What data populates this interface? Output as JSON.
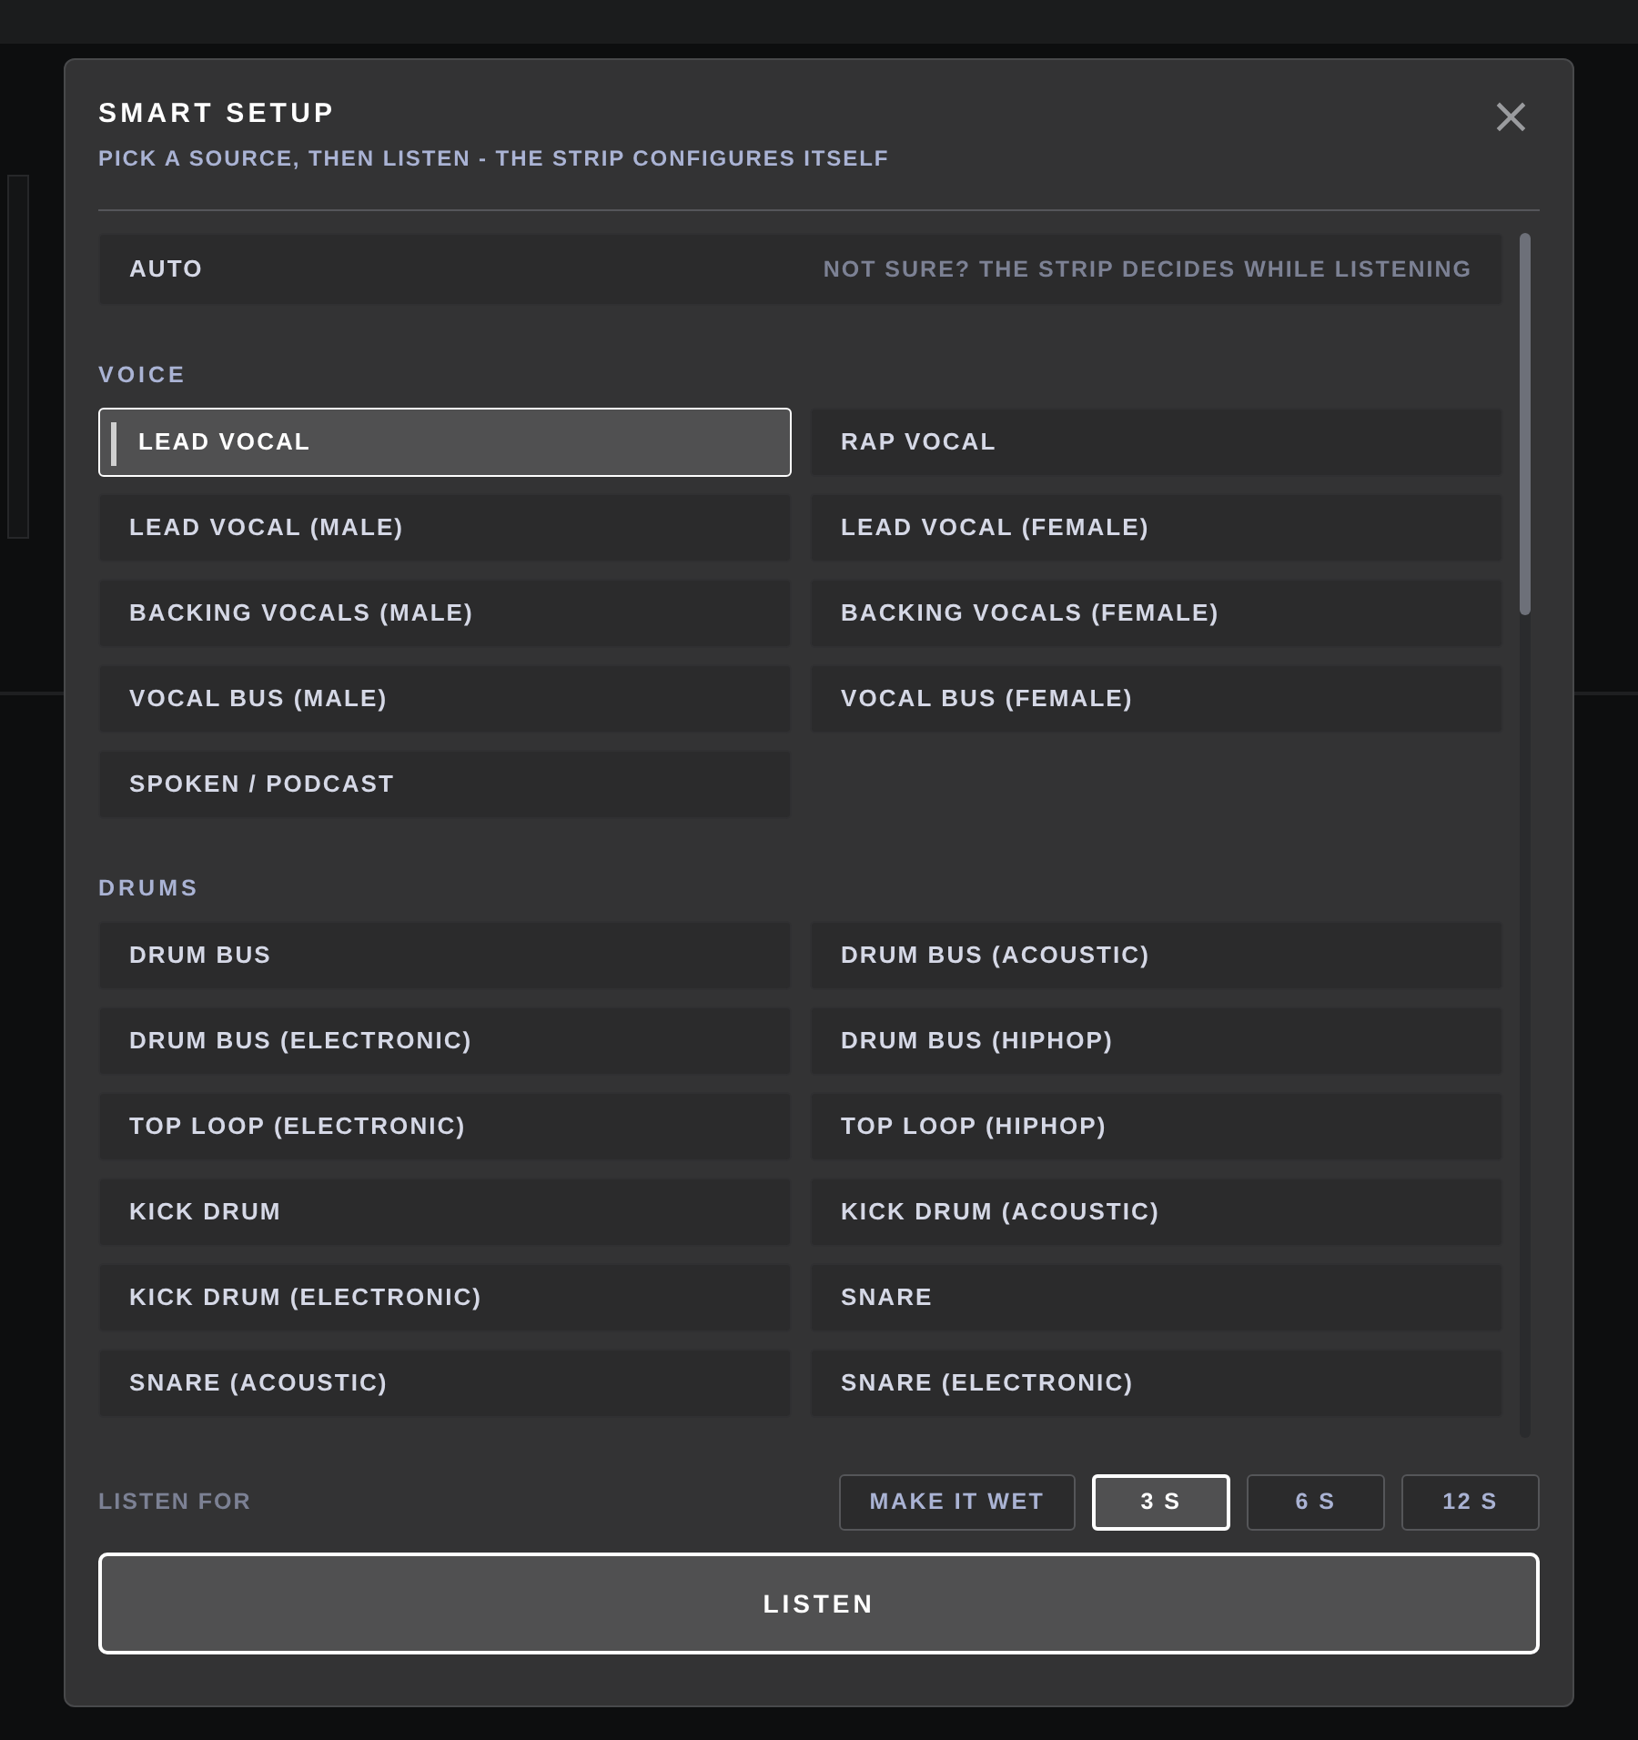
{
  "dialog": {
    "title": "SMART SETUP",
    "subtitle": "PICK A SOURCE, THEN LISTEN - THE STRIP CONFIGURES ITSELF",
    "close": "×"
  },
  "auto": {
    "label": "AUTO",
    "hint": "NOT SURE? THE STRIP DECIDES WHILE LISTENING",
    "selected": false
  },
  "sections": [
    {
      "heading": "VOICE",
      "items": [
        {
          "label": "LEAD VOCAL",
          "selected": true
        },
        {
          "label": "RAP VOCAL",
          "selected": false
        },
        {
          "label": "LEAD VOCAL (MALE)",
          "selected": false
        },
        {
          "label": "LEAD VOCAL (FEMALE)",
          "selected": false
        },
        {
          "label": "BACKING VOCALS (MALE)",
          "selected": false
        },
        {
          "label": "BACKING VOCALS (FEMALE)",
          "selected": false
        },
        {
          "label": "VOCAL BUS (MALE)",
          "selected": false
        },
        {
          "label": "VOCAL BUS (FEMALE)",
          "selected": false
        },
        {
          "label": "SPOKEN / PODCAST",
          "selected": false
        }
      ]
    },
    {
      "heading": "DRUMS",
      "items": [
        {
          "label": "DRUM BUS",
          "selected": false
        },
        {
          "label": "DRUM BUS (ACOUSTIC)",
          "selected": false
        },
        {
          "label": "DRUM BUS (ELECTRONIC)",
          "selected": false
        },
        {
          "label": "DRUM BUS (HIPHOP)",
          "selected": false
        },
        {
          "label": "TOP LOOP (ELECTRONIC)",
          "selected": false
        },
        {
          "label": "TOP LOOP (HIPHOP)",
          "selected": false
        },
        {
          "label": "KICK DRUM",
          "selected": false
        },
        {
          "label": "KICK DRUM (ACOUSTIC)",
          "selected": false
        },
        {
          "label": "KICK DRUM (ELECTRONIC)",
          "selected": false
        },
        {
          "label": "SNARE",
          "selected": false
        },
        {
          "label": "SNARE (ACOUSTIC)",
          "selected": false
        },
        {
          "label": "SNARE (ELECTRONIC)",
          "selected": false
        }
      ]
    }
  ],
  "listen_for": {
    "label": "LISTEN FOR",
    "options": [
      {
        "label": "MAKE IT WET",
        "kind": "toggle",
        "selected": false
      },
      {
        "label": "3 S",
        "kind": "duration",
        "selected": true
      },
      {
        "label": "6 S",
        "kind": "duration",
        "selected": false
      },
      {
        "label": "12 S",
        "kind": "duration",
        "selected": false
      }
    ]
  },
  "listen_button": "LISTEN"
}
